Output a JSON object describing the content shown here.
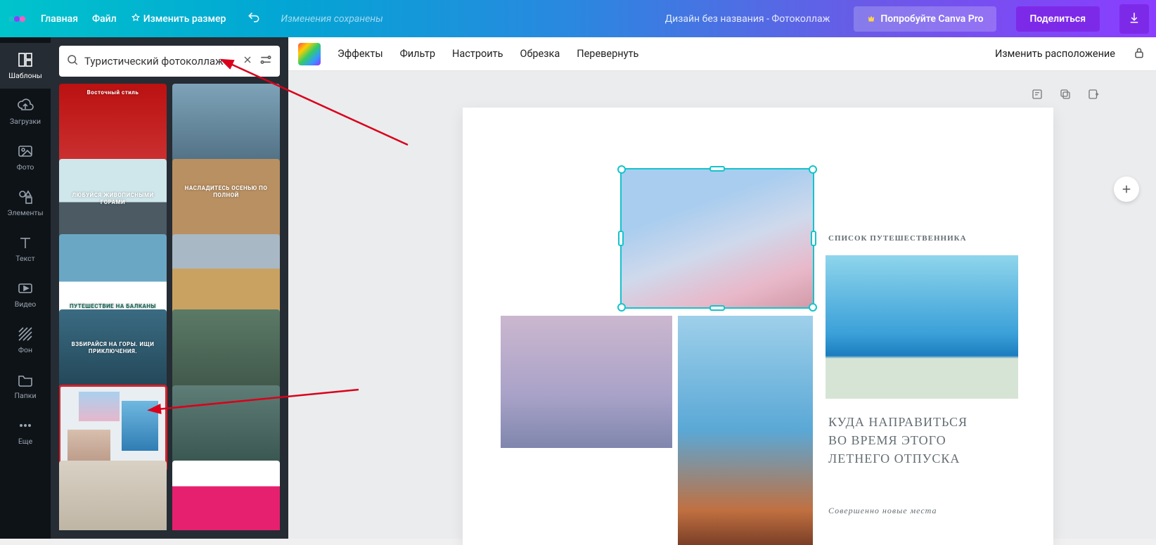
{
  "topbar": {
    "home": "Главная",
    "file": "Файл",
    "resize": "Изменить размер",
    "saved": "Изменения сохранены",
    "doc_title": "Дизайн без названия - Фотоколлаж",
    "try_pro": "Попробуйте Canva Pro",
    "share": "Поделиться"
  },
  "rail": {
    "templates": "Шаблоны",
    "uploads": "Загрузки",
    "photos": "Фото",
    "elements": "Элементы",
    "text": "Текст",
    "video": "Видео",
    "background": "Фон",
    "folders": "Папки",
    "more": "Еще"
  },
  "search": {
    "value": "Туристический фотоколлаж"
  },
  "templates": {
    "t1": "Восточный стиль",
    "t2": "",
    "t3": "ЛЮБУЙСЯ ЖИВОПИСНЫМИ ГОРАМИ",
    "t4": "НАСЛАДИТЕСЬ ОСЕНЬЮ ПО ПОЛНОЙ",
    "t5": "ПУТЕШЕСТВИЕ НА БАЛКАНЫ",
    "t6": "",
    "t7": "ВЗБИРАЙСЯ НА ГОРЫ. ИЩИ ПРИКЛЮЧЕНИЯ.",
    "t8": "",
    "t9": "",
    "t10": "",
    "t11": "",
    "t12": ""
  },
  "ctx": {
    "effects": "Эффекты",
    "filter": "Фильтр",
    "adjust": "Настроить",
    "crop": "Обрезка",
    "flip": "Перевернуть",
    "position": "Изменить расположение"
  },
  "page": {
    "list_title": "СПИСОК ПУТЕШЕСТВЕННИКА",
    "headline": "КУДА НАПРАВИТЬСЯ ВО ВРЕМЯ ЭТОГО ЛЕТНЕГО ОТПУСКА",
    "sub": "Совершенно новые места"
  }
}
